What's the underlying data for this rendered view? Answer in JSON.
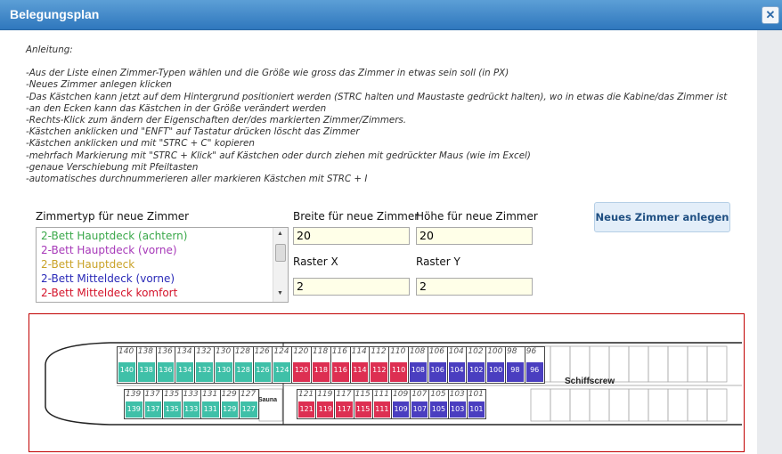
{
  "dialog": {
    "title": "Belegungsplan"
  },
  "instructions": {
    "heading": "Anleitung:",
    "lines": [
      "-Aus der Liste einen Zimmer-Typen wählen und die Größe wie gross das Zimmer in etwas sein soll (in PX)",
      "-Neues Zimmer anlegen klicken",
      "-Das Kästchen kann jetzt auf dem Hintergrund positioniert werden (STRC halten und Maustaste gedrückt halten), wo in etwas die Kabine/das Zimmer ist",
      "-an den Ecken kann das Kästchen in der Größe verändert werden",
      "-Rechts-Klick zum ändern der Eigenschaften der/des markierten Zimmer/Zimmers.",
      "-Kästchen anklicken und \"ENFT\" auf Tastatur drücken löscht das Zimmer",
      "-Kästchen anklicken und mit \"STRC + C\" kopieren",
      "-mehrfach Markierung mit \"STRC + Klick\" auf Kästchen oder durch ziehen mit gedrückter Maus (wie im Excel)",
      "-genaue Verschiebung mit Pfeiltasten",
      "-automatisches durchnummerieren aller markieren Kästchen mit STRC + I"
    ]
  },
  "form": {
    "room_type_label": "Zimmertyp für neue Zimmer",
    "room_types": [
      {
        "label": "2-Bett Hauptdeck (achtern)",
        "color": "#3aa84a"
      },
      {
        "label": "2-Bett Hauptdeck (vorne)",
        "color": "#a637b8"
      },
      {
        "label": "2-Bett Hauptdeck",
        "color": "#c9a227"
      },
      {
        "label": "2-Bett Mitteldeck (vorne)",
        "color": "#2a2ab8"
      },
      {
        "label": "2-Bett Mitteldeck komfort",
        "color": "#d4132a"
      }
    ],
    "width_label": "Breite für neue Zimmer",
    "width_value": "20",
    "height_label": "Höhe für neue Zimmer",
    "height_value": "20",
    "grid_x_label": "Raster X",
    "grid_x_value": "2",
    "grid_y_label": "Raster Y",
    "grid_y_value": "2",
    "new_room_button": "Neues Zimmer anlegen"
  },
  "deckplan": {
    "crew_label": "Schiffscrew",
    "sauna_label": "Sauna",
    "colors": {
      "teal": "#3fc0a8",
      "red": "#dd2f52",
      "blue": "#4a3ec0"
    },
    "top_row": [
      {
        "n": "140",
        "c": "teal"
      },
      {
        "n": "138",
        "c": "teal"
      },
      {
        "n": "136",
        "c": "teal"
      },
      {
        "n": "134",
        "c": "teal"
      },
      {
        "n": "132",
        "c": "teal"
      },
      {
        "n": "130",
        "c": "teal"
      },
      {
        "n": "128",
        "c": "teal"
      },
      {
        "n": "126",
        "c": "teal"
      },
      {
        "n": "124",
        "c": "teal"
      },
      {
        "n": "120",
        "c": "red"
      },
      {
        "n": "118",
        "c": "red"
      },
      {
        "n": "116",
        "c": "red"
      },
      {
        "n": "114",
        "c": "red"
      },
      {
        "n": "112",
        "c": "red"
      },
      {
        "n": "110",
        "c": "red"
      },
      {
        "n": "108",
        "c": "blue"
      },
      {
        "n": "106",
        "c": "blue"
      },
      {
        "n": "104",
        "c": "blue"
      },
      {
        "n": "102",
        "c": "blue"
      },
      {
        "n": "100",
        "c": "blue"
      },
      {
        "n": "98",
        "c": "blue"
      },
      {
        "n": "96",
        "c": "blue"
      }
    ],
    "bottom_row_left": [
      {
        "n": "139",
        "c": "teal"
      },
      {
        "n": "137",
        "c": "teal"
      },
      {
        "n": "135",
        "c": "teal"
      },
      {
        "n": "133",
        "c": "teal"
      },
      {
        "n": "131",
        "c": "teal"
      },
      {
        "n": "129",
        "c": "teal"
      },
      {
        "n": "127",
        "c": "teal"
      }
    ],
    "bottom_row_right": [
      {
        "n": "121",
        "c": "red"
      },
      {
        "n": "119",
        "c": "red"
      },
      {
        "n": "117",
        "c": "red"
      },
      {
        "n": "115",
        "c": "red"
      },
      {
        "n": "111",
        "c": "red"
      },
      {
        "n": "109",
        "c": "blue"
      },
      {
        "n": "107",
        "c": "blue"
      },
      {
        "n": "105",
        "c": "blue"
      },
      {
        "n": "103",
        "c": "blue"
      },
      {
        "n": "101",
        "c": "blue"
      }
    ]
  }
}
